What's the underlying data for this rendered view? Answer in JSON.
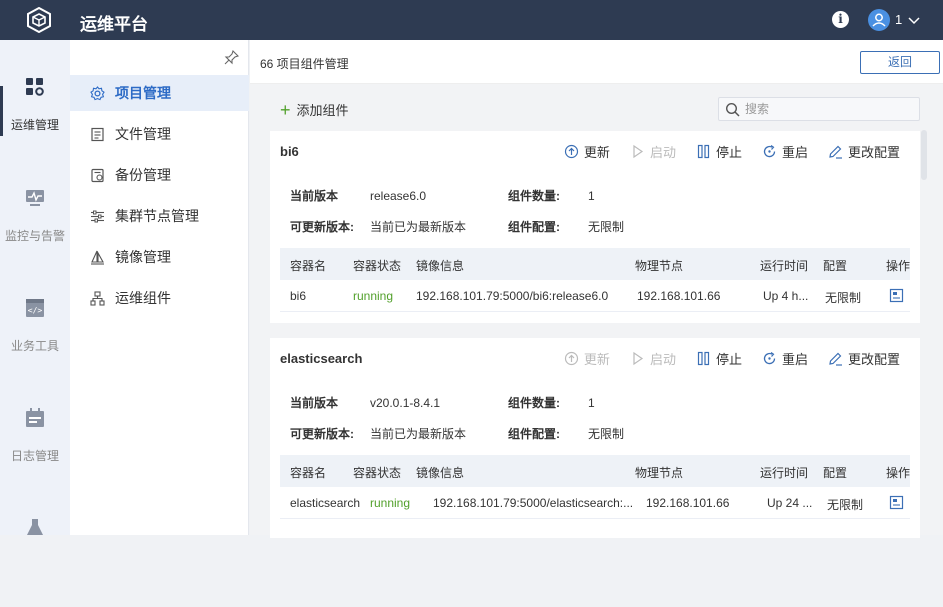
{
  "app": {
    "title": "运维平台",
    "user_name": "1"
  },
  "rail": {
    "items": [
      {
        "label": "运维管理",
        "icon": "apps-gear-icon"
      },
      {
        "label": "监控与告警",
        "icon": "monitor-icon"
      },
      {
        "label": "业务工具",
        "icon": "code-window-icon"
      },
      {
        "label": "日志管理",
        "icon": "calendar-icon"
      }
    ]
  },
  "menu": {
    "items": [
      {
        "label": "项目管理",
        "icon": "gear-icon"
      },
      {
        "label": "文件管理",
        "icon": "file-icon"
      },
      {
        "label": "备份管理",
        "icon": "backup-icon"
      },
      {
        "label": "集群节点管理",
        "icon": "sliders-icon"
      },
      {
        "label": "镜像管理",
        "icon": "sail-icon"
      },
      {
        "label": "运维组件",
        "icon": "network-icon"
      }
    ]
  },
  "header": {
    "breadcrumb": "66 项目组件管理",
    "back_label": "返回"
  },
  "toolbar": {
    "add_label": "添加组件",
    "search_placeholder": "搜索"
  },
  "actions": {
    "update": "更新",
    "start": "启动",
    "stop": "停止",
    "restart": "重启",
    "config": "更改配置"
  },
  "labels": {
    "current_version": "当前版本",
    "updatable_version": "可更新版本:",
    "component_count": "组件数量:",
    "component_config": "组件配置:"
  },
  "columns": [
    "容器名",
    "容器状态",
    "镜像信息",
    "物理节点",
    "运行时间",
    "配置",
    "操作"
  ],
  "cards": [
    {
      "name": "bi6",
      "current_version": "release6.0",
      "updatable": "当前已为最新版本",
      "count": "1",
      "config": "无限制",
      "row": {
        "name": "bi6",
        "status": "running",
        "image": "192.168.101.79:5000/bi6:release6.0",
        "node": "192.168.101.66",
        "uptime": "Up 4 h...",
        "config": "无限制"
      }
    },
    {
      "name": "elasticsearch",
      "current_version": "v20.0.1-8.4.1",
      "updatable": "当前已为最新版本",
      "count": "1",
      "config": "无限制",
      "row": {
        "name": "elasticsearch",
        "status": "running",
        "image": "192.168.101.79:5000/elasticsearch:...",
        "node": "192.168.101.66",
        "uptime": "Up 24 ...",
        "config": "无限制"
      }
    }
  ]
}
